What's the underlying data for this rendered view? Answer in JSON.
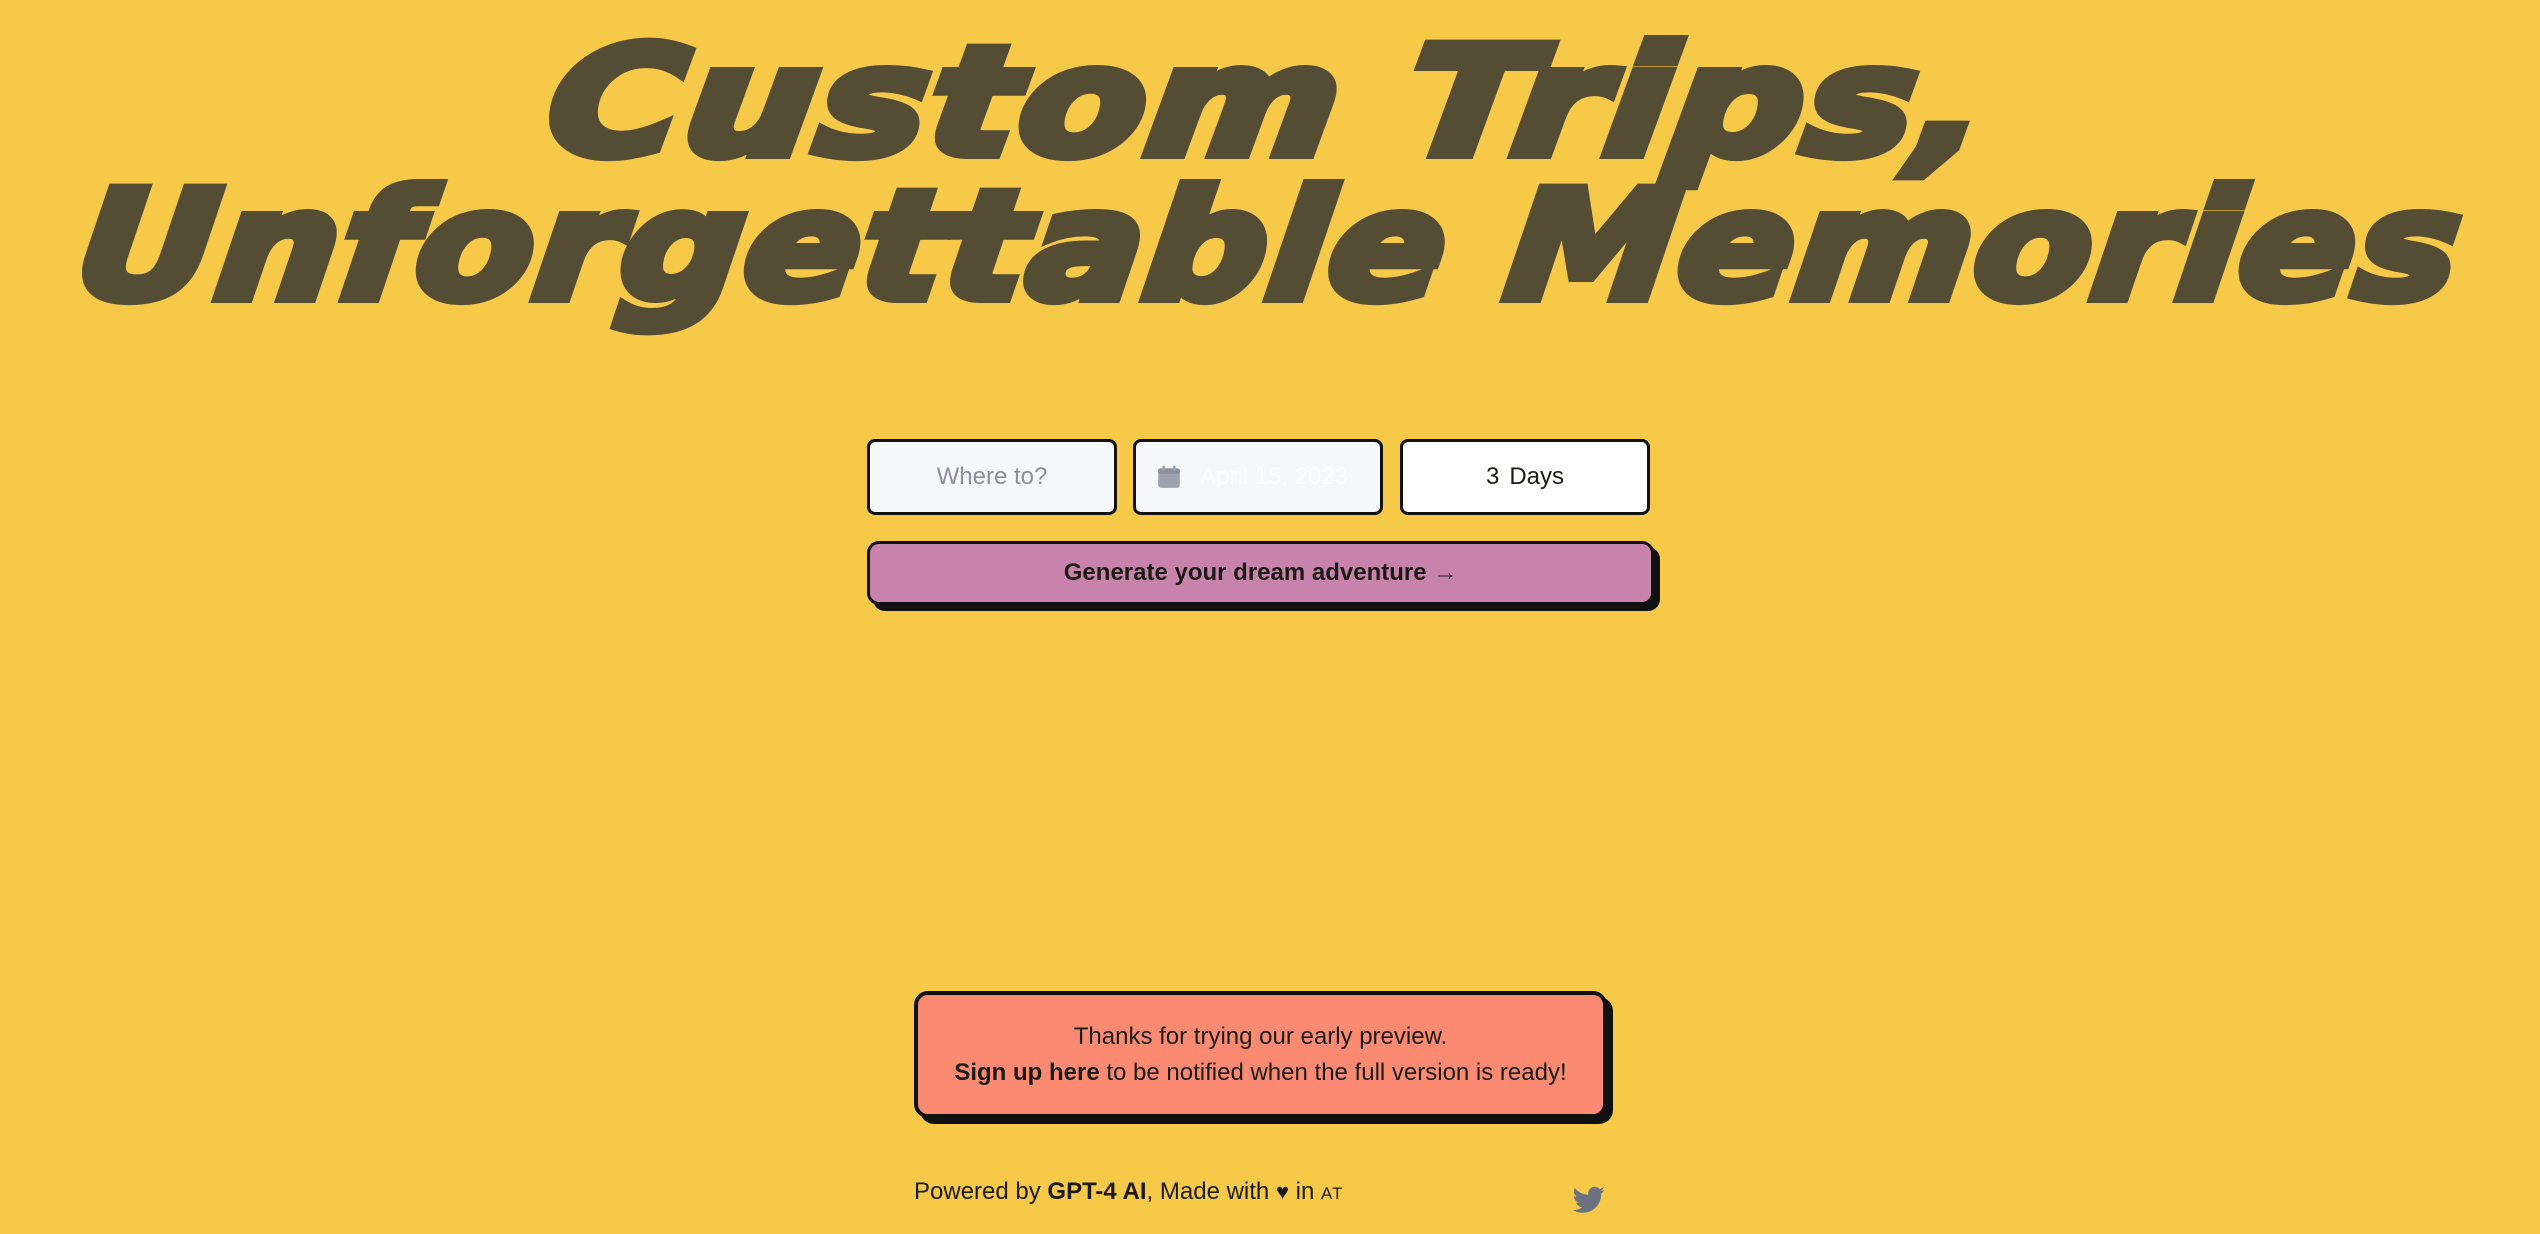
{
  "headline": {
    "line1": "Custom Trips,",
    "line2": "Unforgettable Memories"
  },
  "form": {
    "destination_placeholder": "Where to?",
    "destination_value": "",
    "date_value": "April 15, 2023",
    "days_value": "3",
    "days_unit": "Days",
    "generate_label": "Generate your dream adventure →"
  },
  "notice": {
    "line1": "Thanks for trying our early preview.",
    "signup_link": "Sign up here",
    "line2_rest": " to be notified when the full version is ready!"
  },
  "footer": {
    "powered_by": "Powered by ",
    "ai_name": "GPT-4 AI",
    "made_with": ", Made with ",
    "heart": "♥",
    "in": " in ",
    "location": "AT"
  },
  "icons": {
    "calendar": "calendar-icon",
    "twitter": "twitter-icon"
  },
  "colors": {
    "background": "#f7c948",
    "headline": "#554c34",
    "button": "#c883ac",
    "notice": "#fa8a72",
    "border": "#111111",
    "twitter_icon": "#6b7280"
  }
}
